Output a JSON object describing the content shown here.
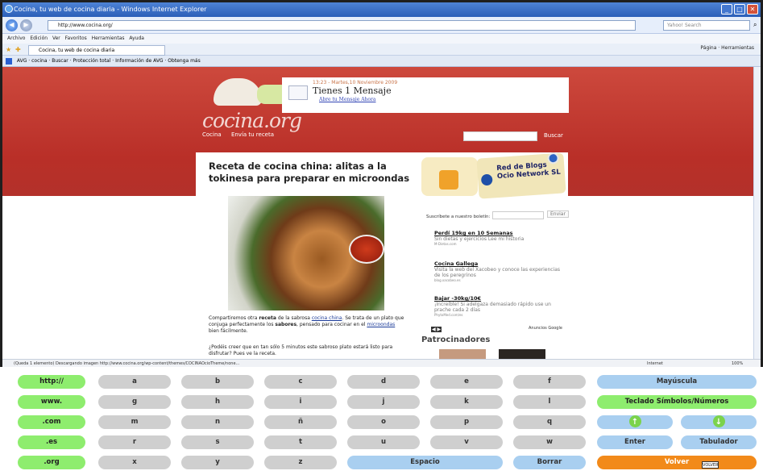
{
  "window": {
    "title": "Cocina, tu web de cocina diaria - Windows Internet Explorer",
    "url": "http://www.cocina.org/",
    "search_placeholder": "Yahoo! Search",
    "menu": "Archivo Edición Ver Favoritos Herramientas Ayuda",
    "tab_label": "Cocina, tu web de cocina diaria",
    "tab_tools": "Página · Herramientas",
    "avg_bar": "AVG · cocina · Buscar · Protección total · Información de AVG · Obtenga más",
    "status": "(Queda 1 elemento) Descargando imagen http://www.cocina.org/wp-content/themes/COCINAOcioTheme/none...",
    "status_zone": "Internet",
    "zoom": "100%"
  },
  "site": {
    "logo": "cocina.org",
    "msg_date": "13:23 - Martes,10 Noviembre 2009",
    "msg_title": "Tienes 1 Mensaje",
    "msg_link": "Abre tu Mensaje Ahora",
    "nav": [
      "Cocina",
      "Envía tu receta"
    ],
    "search_label": "Buscar",
    "headline": "Receta de cocina china: alitas a la tokinesa para preparar en microondas",
    "para1_a": "Compartiremos otra ",
    "para1_b": "receta",
    "para1_c": " de la sabrosa ",
    "para1_d": "cocina china",
    "para1_e": ". Se trata de un plato que conjuga perfectamente los ",
    "para1_f": "sabores",
    "para1_g": ", pensado para cocinar en el ",
    "para1_h": "microondas",
    "para1_i": " bien fácilmente.",
    "para2": "¿Podéis creer que en tan sólo 5 minutos este sabroso plato estará listo para disfrutar? Pues ve la receta.",
    "red_blogs_line1": "Red de Blogs",
    "red_blogs_line2": "Ocio Network SL",
    "subscribe_label": "Suscríbete a nuestro boletín:",
    "subscribe_btn": "Enviar",
    "ads": [
      {
        "title": "Perdí 19kg en 10 Semanas",
        "desc": "Sin dietas y ejercicios Lee mi historia",
        "url": "M-Dietas.com"
      },
      {
        "title": "Cocina Gallega",
        "desc": "Visita la web del Xacobeo y conoce las experiencias de los peregrinos",
        "url": "blog.xacobeo.es"
      },
      {
        "title": "Bajar -30kg/10€",
        "desc": "¡Increíble! Si adelgaza demasiado rápido use un prache cada 2 días",
        "url": "PhytoMed.com/es"
      }
    ],
    "ads_by": "Anuncios Google",
    "sponsors": "Patrocinadores"
  },
  "keyboard": {
    "rows": [
      [
        "http://",
        "a",
        "b",
        "c",
        "d",
        "e",
        "f",
        "Mayúscula"
      ],
      [
        "www.",
        "g",
        "h",
        "i",
        "j",
        "k",
        "l",
        "Teclado Símbolos/Números"
      ],
      [
        ".com",
        "m",
        "n",
        "ñ",
        "o",
        "p",
        "q"
      ],
      [
        ".es",
        "r",
        "s",
        "t",
        "u",
        "v",
        "w",
        "Enter",
        "Tabulador"
      ],
      [
        ".org",
        "x",
        "y",
        "z",
        "Espacio",
        "Borrar",
        "Volver"
      ]
    ],
    "volver_tag": "VOLVER"
  }
}
